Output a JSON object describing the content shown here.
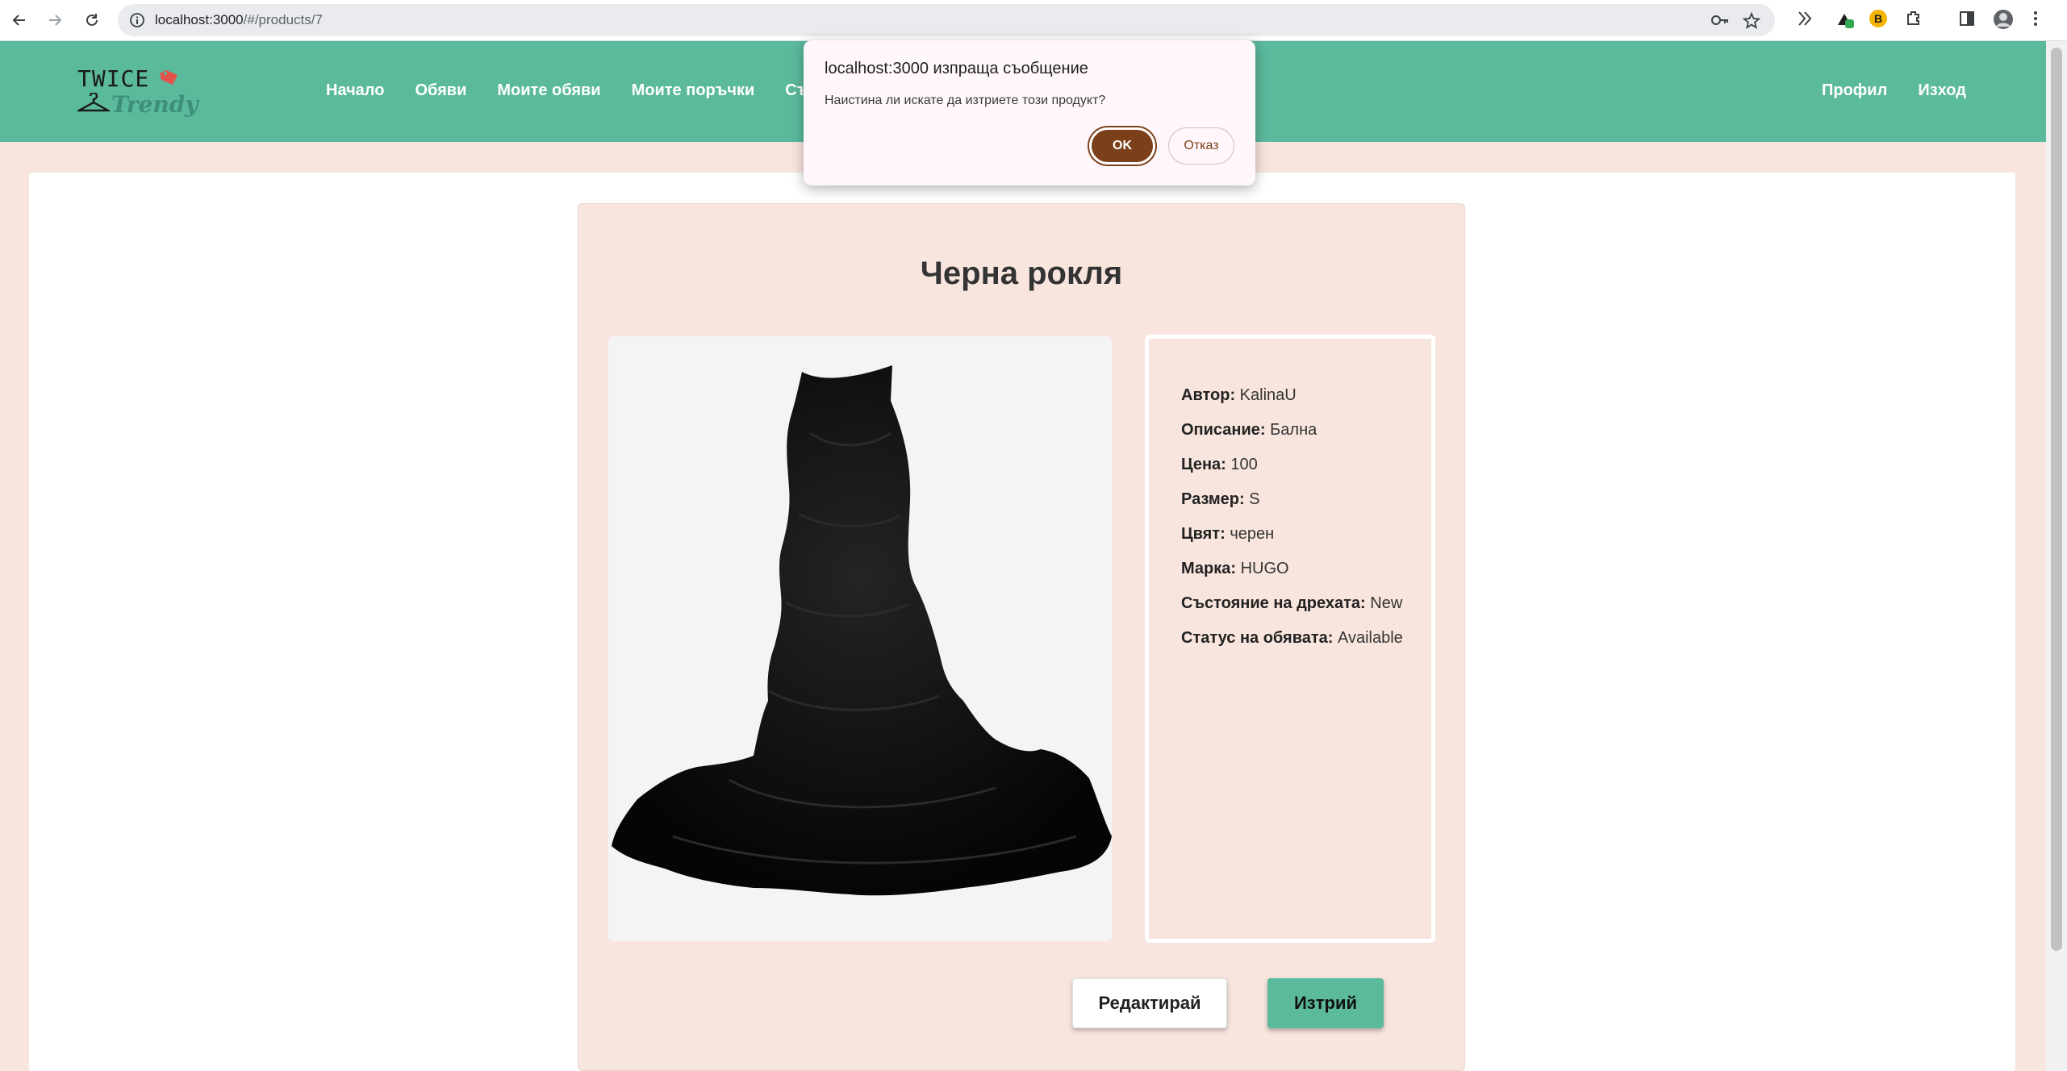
{
  "browser": {
    "url_host": "localhost:3000",
    "url_path": "/#/products/7"
  },
  "header": {
    "logo_line1": "TWICE",
    "logo_line2": "Trendy",
    "nav": [
      "Начало",
      "Обяви",
      "Моите обяви",
      "Моите поръчки",
      "Съ"
    ],
    "right_nav": [
      "Профил",
      "Изход"
    ]
  },
  "product": {
    "title": "Черна рокля",
    "details": [
      {
        "label": "Автор:",
        "value": "KalinaU"
      },
      {
        "label": "Описание:",
        "value": "Бална"
      },
      {
        "label": "Цена:",
        "value": "100"
      },
      {
        "label": "Размер:",
        "value": "S"
      },
      {
        "label": "Цвят:",
        "value": "черен"
      },
      {
        "label": "Марка:",
        "value": "HUGO"
      },
      {
        "label": "Състояние на дрехата:",
        "value": "New"
      },
      {
        "label": "Статус на обявата:",
        "value": "Available"
      }
    ],
    "edit_label": "Редактирай",
    "delete_label": "Изтрий"
  },
  "dialog": {
    "title": "localhost:3000 изпраща съобщение",
    "message": "Наистина ли искате да изтриете този продукт?",
    "ok_label": "OK",
    "cancel_label": "Отказ"
  },
  "colors": {
    "header_bg": "#5bb99c",
    "page_bg": "#f8e6de",
    "ok_button": "#7b4019"
  }
}
